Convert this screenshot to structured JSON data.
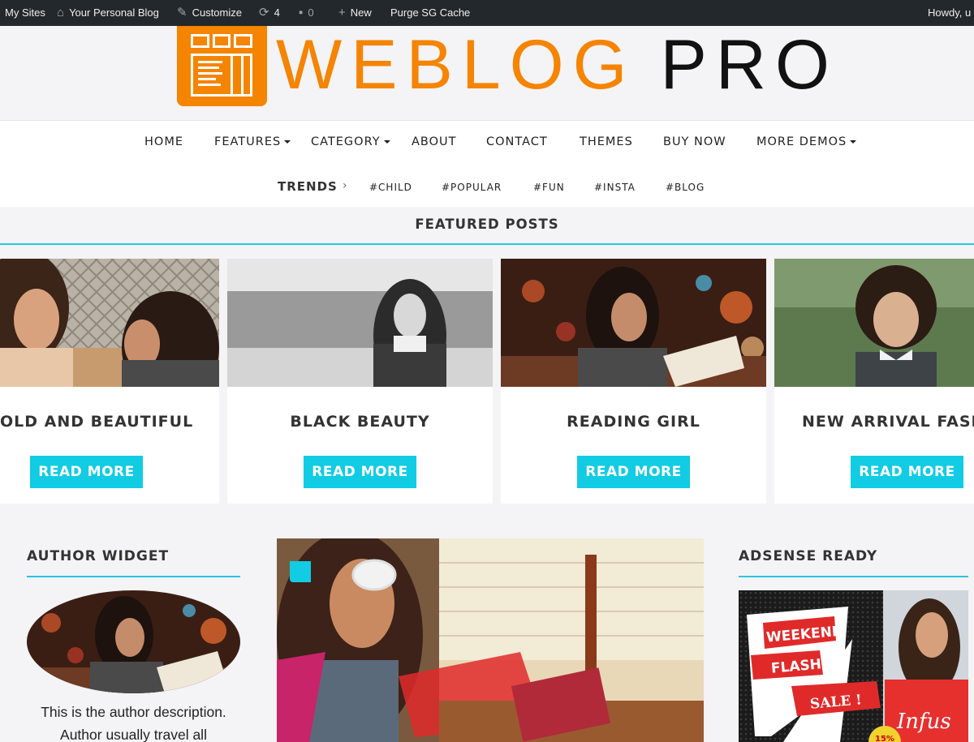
{
  "admin_bar": {
    "my_sites": "My Sites",
    "site_name": "Your Personal Blog",
    "customize": "Customize",
    "updates_count": "4",
    "comments_count": "0",
    "new": "New",
    "purge": "Purge SG Cache",
    "howdy": "Howdy, u"
  },
  "header": {
    "logo_word1": "WEBLOG",
    "logo_word2": "PRO"
  },
  "nav": {
    "items": [
      {
        "label": "HOME"
      },
      {
        "label": "FEATURES"
      },
      {
        "label": "CATEGORY"
      },
      {
        "label": "ABOUT"
      },
      {
        "label": "CONTACT"
      },
      {
        "label": "THEMES"
      },
      {
        "label": "BUY NOW"
      },
      {
        "label": "MORE DEMOS"
      }
    ],
    "trends_label": "TRENDS",
    "trend_tags": [
      "#CHILD",
      "#POPULAR",
      "#FUN",
      "#INSTA",
      "#BLOG"
    ]
  },
  "featured": {
    "title": "FEATURED POSTS",
    "posts": [
      {
        "title": "OLD AND BEAUTIFUL",
        "button": "READ MORE"
      },
      {
        "title": "BLACK BEAUTY",
        "button": "READ MORE"
      },
      {
        "title": "READING GIRL",
        "button": "READ MORE"
      },
      {
        "title": "NEW ARRIVAL FASH",
        "button": "READ MORE"
      }
    ]
  },
  "author_widget": {
    "title": "AUTHOR WIDGET",
    "description": "This is the author description. Author usually travel all"
  },
  "adsense": {
    "title": "ADSENSE READY",
    "ad_text": [
      "WEEKEND",
      "FLASH",
      "SALE !",
      "Infus",
      "15%"
    ]
  },
  "colors": {
    "brand_orange": "#f58400",
    "accent_cyan": "#11cce3",
    "admin_bar_bg": "#23282d"
  }
}
